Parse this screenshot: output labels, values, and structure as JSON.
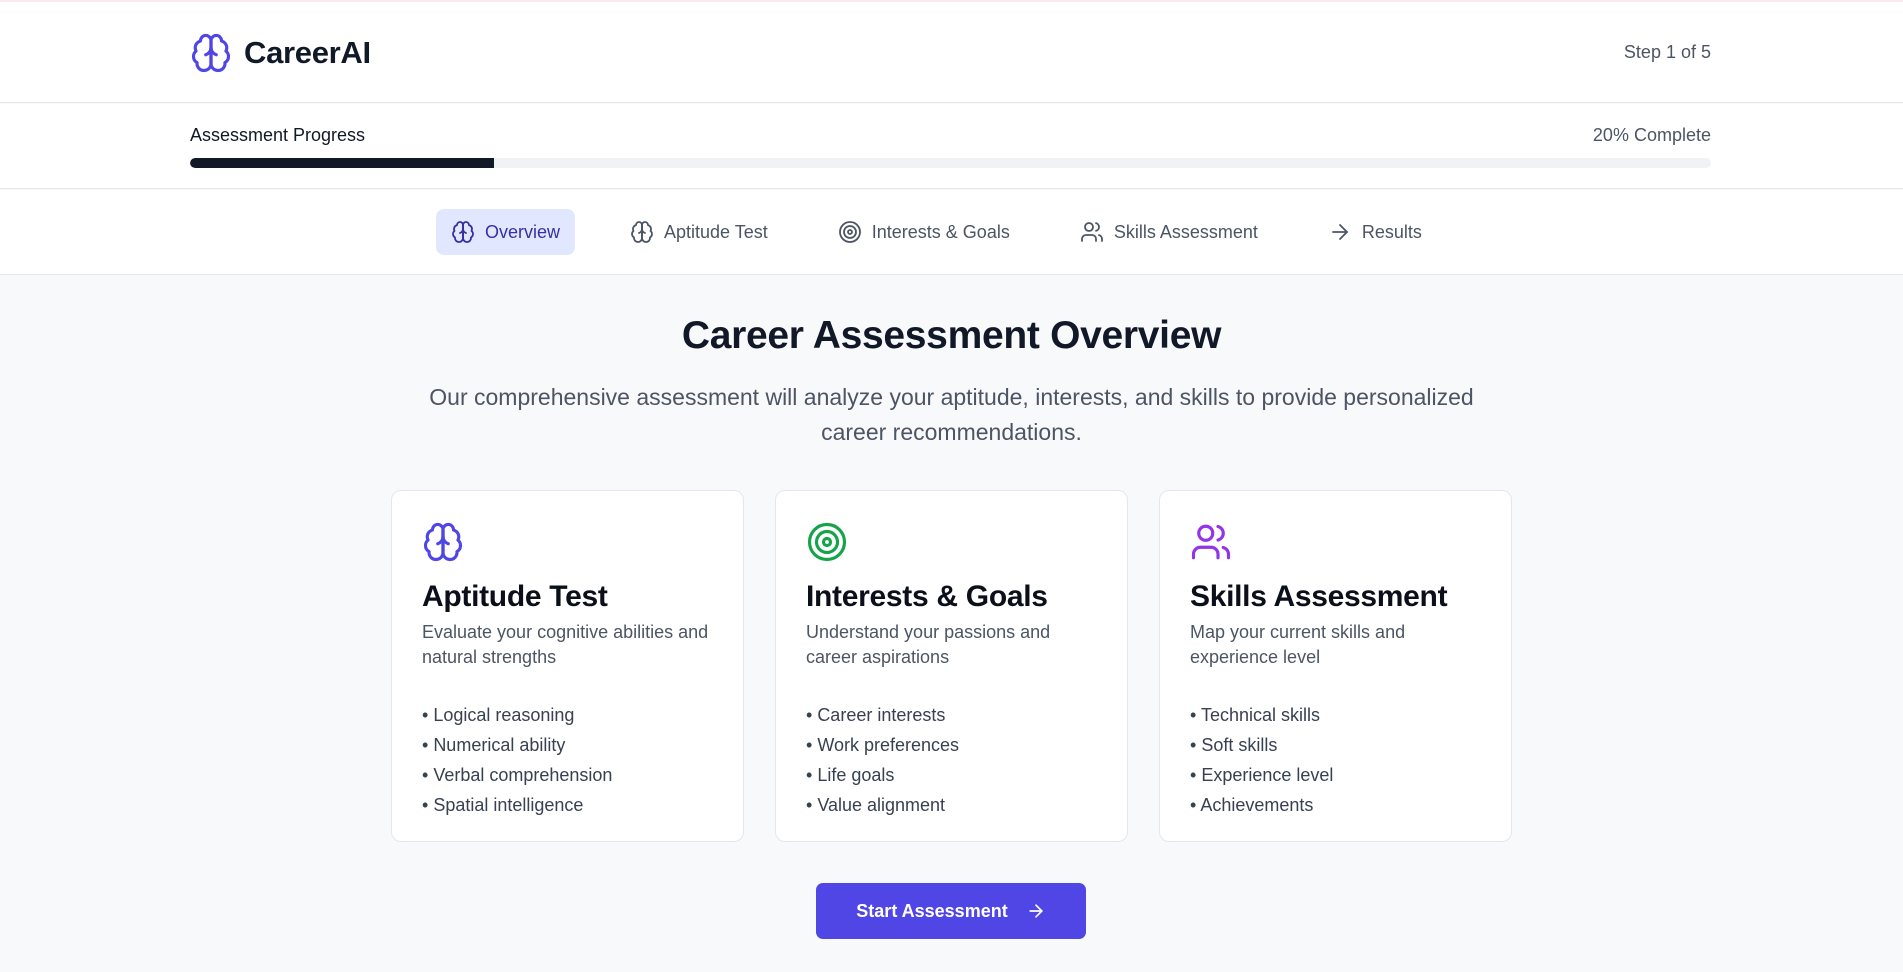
{
  "header": {
    "brand_name": "CareerAI",
    "brand_icon": "brain-icon",
    "step_label": "Step 1 of 5"
  },
  "progress": {
    "label": "Assessment Progress",
    "percent_label": "20% Complete",
    "value": 0.2
  },
  "tabs": [
    {
      "label": "Overview",
      "icon": "brain-icon",
      "active": true
    },
    {
      "label": "Aptitude Test",
      "icon": "brain-icon",
      "active": false
    },
    {
      "label": "Interests & Goals",
      "icon": "target-icon",
      "active": false
    },
    {
      "label": "Skills Assessment",
      "icon": "users-icon",
      "active": false
    },
    {
      "label": "Results",
      "icon": "arrow-right-icon",
      "active": false
    }
  ],
  "main": {
    "title": "Career Assessment Overview",
    "subtitle": "Our comprehensive assessment will analyze your aptitude, interests, and skills to provide personalized career recommendations.",
    "cards": [
      {
        "icon": "brain-icon",
        "icon_color": "#4f46e5",
        "title": "Aptitude Test",
        "description": "Evaluate your cognitive abilities and natural strengths",
        "items": [
          "Logical reasoning",
          "Numerical ability",
          "Verbal comprehension",
          "Spatial intelligence"
        ]
      },
      {
        "icon": "target-icon",
        "icon_color": "#16a34a",
        "title": "Interests & Goals",
        "description": "Understand your passions and career aspirations",
        "items": [
          "Career interests",
          "Work preferences",
          "Life goals",
          "Value alignment"
        ]
      },
      {
        "icon": "users-icon",
        "icon_color": "#9333ea",
        "title": "Skills Assessment",
        "description": "Map your current skills and experience level",
        "items": [
          "Technical skills",
          "Soft skills",
          "Experience level",
          "Achievements"
        ]
      }
    ],
    "start_button_label": "Start Assessment"
  },
  "colors": {
    "accent": "#4f46e5",
    "active_tab_bg": "#e0e7ff",
    "progress_fill": "#111827"
  }
}
